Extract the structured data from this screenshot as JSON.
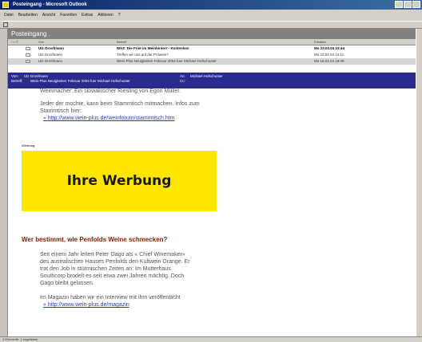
{
  "window": {
    "title": "Posteingang - Microsoft Outlook"
  },
  "menu": [
    "Datei",
    "Bearbeiten",
    "Ansicht",
    "Favoriten",
    "Extras",
    "Aktionen",
    "?"
  ],
  "folder": {
    "title": "Posteingang ."
  },
  "columns": {
    "from": "Von",
    "subject": "Betreff",
    "received": "Erhalten"
  },
  "messages": [
    {
      "from": "Ulz Grosfmann",
      "subject": "WAZ: Die Frist im Weinhinterr - Kostenlos!",
      "received": "Mo 23.02.04 23:44",
      "bold": true
    },
    {
      "from": "Ulz Grosfmann",
      "subject": "Treffen wir uns auf der Prowein?",
      "received": "Mo 23.02.04 13:11",
      "bold": false
    },
    {
      "from": "Ulz Grosfmann",
      "subject": "Wein-Plus Neuigkeiten Februar 2004 fuer Michael Hofschuster",
      "received": "Mo 16.02.04 19:49",
      "bold": false
    }
  ],
  "preview_header": {
    "from_label": "Von:",
    "from": "Ulz Grosfmann",
    "to_label": "An:",
    "to": "Michael Hofschuster",
    "subject_label": "Betreff:",
    "subject": "Wein-Plus Neuigkeiten Februar 2004 fuer Michael Hofschuster",
    "cc_label": "Cc:"
  },
  "body": {
    "line0": "Weinmacher: Ein slowakischer Riesling von Egon Müller.",
    "para1_l1": "Jeder der mochte, kann beim Stammtisch mitmachen. Infos zum",
    "para1_l2": "Stammtisch hier:",
    "link1": "» http://www.wein-plus.de/weinforum/stammtisch.htm",
    "ad_label": "Werbung:",
    "ad_text": "Ihre Werbung",
    "heading": "Wer bestimmt, wie Penfolds Weine schmecken?",
    "para2_l1": "Seit einem Jahr leitert Peter Gago als « Chief Winemaker»",
    "para2_l2": "des australischen Hauses Penfolds den Kultwein Grange. Er",
    "para2_l3": "trat den Job in stürmischen Zeiten an: Im Mutterhaus",
    "para2_l4": "Southcorp brodelt es seit etwa zwei Jahren mächtig. Doch",
    "para2_l5": "Gago bleibt gelassen.",
    "para3": "Im Magazin haben wir ein Interview mit ihm veröffentlicht",
    "link2": "» http://www.wein-plus.de/magazin"
  },
  "statusbar": {
    "text": "3 Elemente, 1 ungelesen"
  }
}
